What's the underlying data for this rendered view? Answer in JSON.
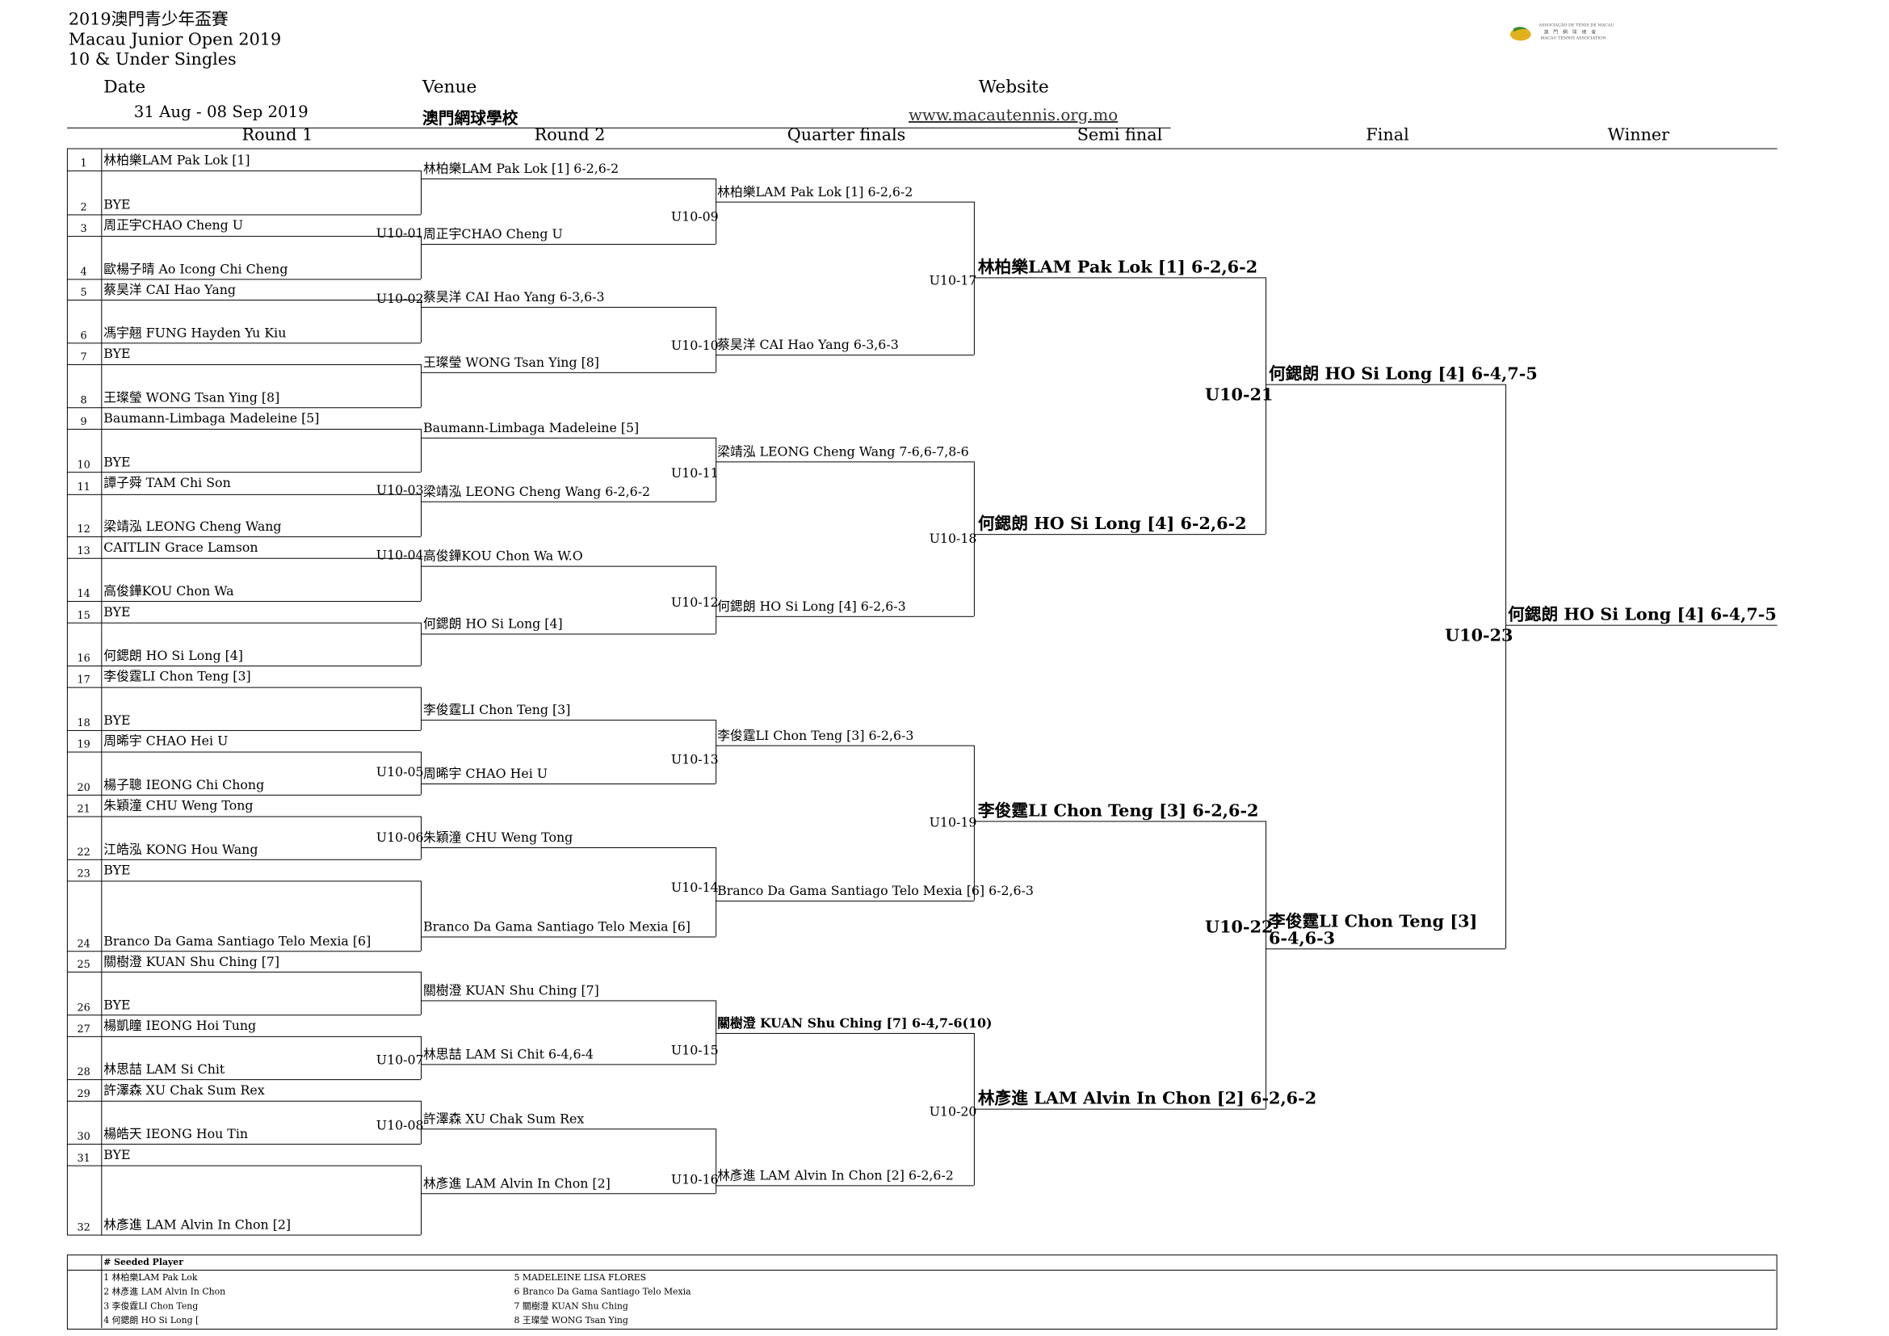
{
  "header": {
    "title_zh": "2019澳門青少年盃賽",
    "title_en": "Macau Junior Open 2019",
    "event": "10 & Under Singles",
    "date_label": "Date",
    "date_value": "31 Aug - 08 Sep 2019",
    "venue_label": "Venue",
    "venue_value": "澳門網球學校",
    "website_label": "Website",
    "website_value": "www.macautennis.org.mo",
    "logo_lines": [
      "ASSOCIAÇÃO DE TÉNIS DE MACAU",
      "澳 門 網 球 總 會",
      "MACAU TENNIS ASSOCIATION"
    ],
    "logo_color": "#e2b21c",
    "logo_leaf_color": "#3c8a2e"
  },
  "rounds": [
    "Round 1",
    "Round 2",
    "Quarter finals",
    "Semi final",
    "Final",
    "Winner"
  ],
  "draw": {
    "entries": [
      "林柏樂LAM Pak Lok [1]",
      "BYE",
      "周正宇CHAO Cheng U",
      "歐楊子晴 Ao Icong Chi Cheng",
      "蔡昊洋 CAI Hao Yang",
      "馮宇翹 FUNG Hayden Yu Kiu",
      "BYE",
      "王璨瑩 WONG Tsan Ying [8]",
      "Baumann-Limbaga Madeleine [5]",
      "BYE",
      "譚子舜 TAM Chi Son",
      "梁靖泓 LEONG Cheng Wang",
      "CAITLIN Grace Lamson",
      "高俊鏵KOU Chon Wa",
      "BYE",
      "何鍶朗 HO Si Long [4]",
      "李俊霆LI Chon Teng [3]",
      "BYE",
      "周晞宇 CHAO Hei U",
      "楊子聰 IEONG Chi Chong",
      "朱穎潼 CHU Weng Tong",
      "江皓泓 KONG Hou Wang",
      "BYE",
      "Branco Da Gama Santiago Telo Mexia [6]",
      "關樹澄 KUAN Shu Ching [7]",
      "BYE",
      "楊凱瞳 IEONG Hoi Tung",
      "林思喆 LAM Si Chit",
      "許澤森 XU Chak Sum Rex",
      "楊皓天 IEONG Hou Tin",
      "BYE",
      "林彥進 LAM Alvin In Chon [2]"
    ],
    "numbers": [
      "1",
      "2",
      "3",
      "4",
      "5",
      "6",
      "7",
      "8",
      "9",
      "10",
      "11",
      "12",
      "13",
      "14",
      "15",
      "16",
      "17",
      "18",
      "19",
      "20",
      "21",
      "22",
      "23",
      "24",
      "25",
      "26",
      "27",
      "28",
      "29",
      "30",
      "31",
      "32"
    ],
    "r2": [
      "林柏樂LAM Pak Lok [1] 6-2,6-2",
      "周正宇CHAO Cheng U",
      "蔡昊洋 CAI Hao Yang 6-3,6-3",
      "王璨瑩 WONG Tsan Ying [8]",
      "Baumann-Limbaga Madeleine [5]",
      "梁靖泓 LEONG Cheng Wang 6-2,6-2",
      "高俊鏵KOU Chon Wa W.O",
      "何鍶朗 HO Si Long [4]",
      "李俊霆LI Chon Teng [3]",
      "周晞宇 CHAO Hei U",
      "朱穎潼 CHU Weng Tong",
      "Branco Da Gama Santiago Telo Mexia [6]",
      "關樹澄 KUAN Shu Ching [7]",
      "林思喆 LAM Si Chit 6-4,6-4",
      "許澤森 XU Chak Sum Rex",
      "林彥進 LAM Alvin In Chon [2]"
    ],
    "r1_codes": [
      "U10-01",
      "U10-02",
      "U10-03",
      "U10-04",
      "U10-05",
      "U10-06",
      "U10-07",
      "U10-08"
    ],
    "qf": [
      "林柏樂LAM Pak Lok [1] 6-2,6-2",
      "蔡昊洋 CAI Hao Yang 6-3,6-3",
      "梁靖泓 LEONG Cheng Wang 7-6,6-7,8-6",
      "何鍶朗 HO Si Long [4] 6-2,6-3",
      "李俊霆LI Chon Teng [3] 6-2,6-3",
      "Branco Da Gama Santiago Telo Mexia [6] 6-2,6-3",
      "關樹澄 KUAN Shu Ching [7] 6-4,7-6(10)",
      "林彥進 LAM Alvin In Chon [2] 6-2,6-2"
    ],
    "r2_codes": [
      "U10-09",
      "U10-10",
      "U10-11",
      "U10-12",
      "U10-13",
      "U10-14",
      "U10-15",
      "U10-16"
    ],
    "sf": [
      "林柏樂LAM Pak Lok [1] 6-2,6-2",
      "何鍶朗 HO Si Long [4] 6-2,6-2",
      "李俊霆LI Chon Teng [3] 6-2,6-2",
      "林彥進 LAM Alvin In Chon [2] 6-2,6-2"
    ],
    "qf_codes": [
      "U10-17",
      "U10-18",
      "U10-19",
      "U10-20"
    ],
    "final": [
      "何鍶朗 HO Si Long [4]   6-4,7-5",
      "李俊霆LI Chon Teng [3] 6-4,6-3"
    ],
    "sf_codes": [
      "U10-21",
      "U10-22"
    ],
    "winner": "何鍶朗 HO Si Long [4]   6-4,7-5",
    "final_code": "U10-23"
  },
  "seeds": {
    "title": "# Seeded Player",
    "left": [
      "1 林柏樂LAM Pak Lok",
      "2 林彥進 LAM Alvin In Chon",
      "3 李俊霆LI Chon Teng",
      "4 何鍶朗 HO Si Long ["
    ],
    "right": [
      "5  MADELEINE LISA FLORES",
      "6 Branco Da Gama Santiago Telo Mexia",
      "7 關樹澄 KUAN Shu Ching",
      "8 王璨瑩 WONG Tsan Ying"
    ]
  }
}
